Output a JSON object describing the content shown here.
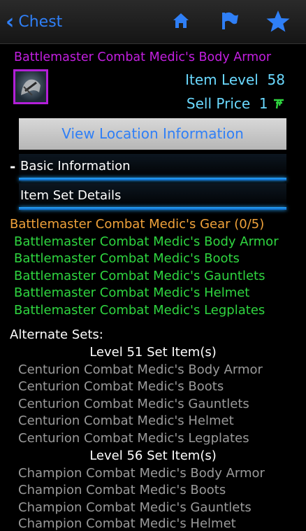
{
  "nav": {
    "back_label": "Chest",
    "icons": [
      "home-icon",
      "flag-icon",
      "star-icon"
    ]
  },
  "item": {
    "name": "Battlemaster Combat Medic's Body Armor",
    "level_label": "Item Level",
    "level_value": "58",
    "price_label": "Sell Price",
    "price_value": "1"
  },
  "buttons": {
    "view_location": "View Location Information"
  },
  "sections": {
    "toggle": "-",
    "basic": "Basic Information",
    "set_details": "Item Set Details"
  },
  "set": {
    "title": "Battlemaster Combat Medic's Gear (0/5)",
    "items": [
      "Battlemaster Combat Medic's Body Armor",
      "Battlemaster Combat Medic's Boots",
      "Battlemaster Combat Medic's Gauntlets",
      "Battlemaster Combat Medic's Helmet",
      "Battlemaster Combat Medic's Legplates"
    ]
  },
  "alternate": {
    "label": "Alternate Sets:",
    "groups": [
      {
        "heading": "Level 51 Set Item(s)",
        "items": [
          "Centurion Combat Medic's Body Armor",
          "Centurion Combat Medic's Boots",
          "Centurion Combat Medic's Gauntlets",
          "Centurion Combat Medic's Helmet",
          "Centurion Combat Medic's Legplates"
        ]
      },
      {
        "heading": "Level 56 Set Item(s)",
        "items": [
          "Champion Combat Medic's Body Armor",
          "Champion Combat Medic's Boots",
          "Champion Combat Medic's Gauntlets",
          "Champion Combat Medic's Helmet"
        ]
      }
    ]
  },
  "colors": {
    "accent": "#2f7ff6",
    "epic": "#c31fe0",
    "set_title": "#f0a23a",
    "set_item": "#2fd640",
    "alt_item": "#9a9a9a",
    "stat": "#6ad9ff"
  }
}
